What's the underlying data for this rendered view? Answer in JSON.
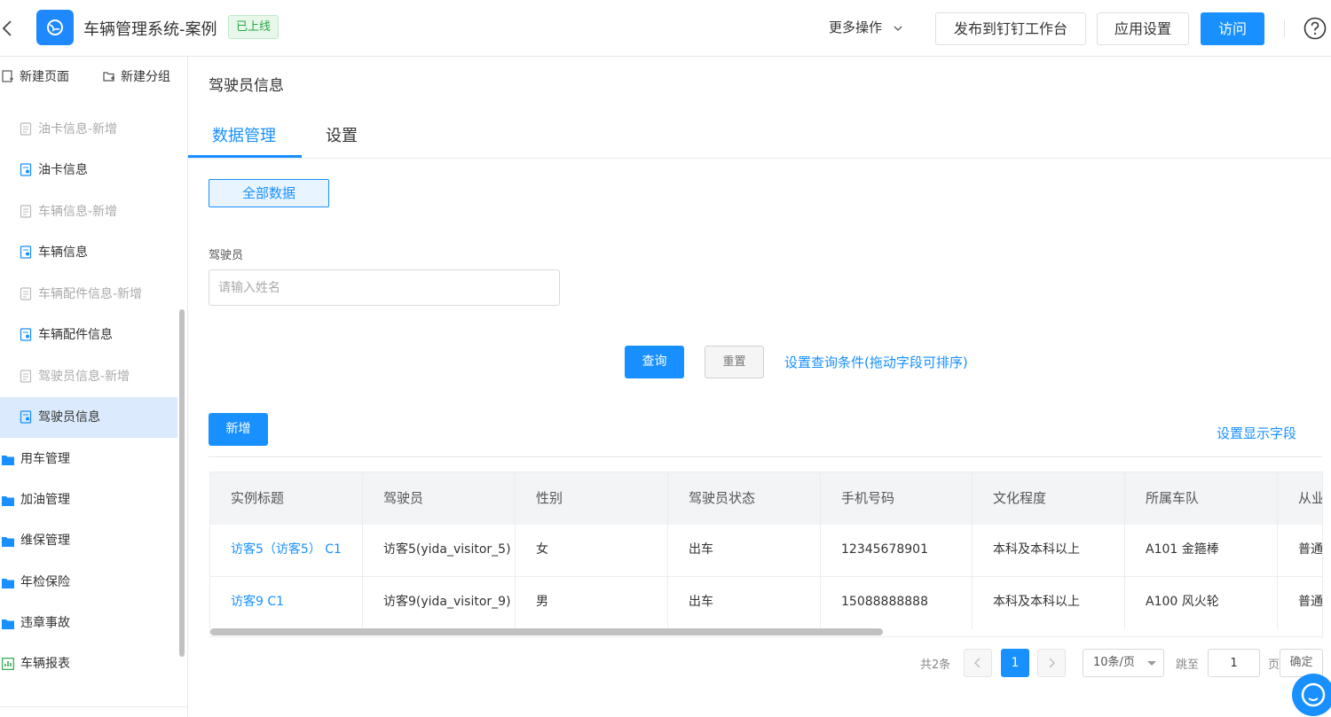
{
  "header": {
    "app_title": "车辆管理系统-案例",
    "status_tag": "已上线",
    "more_ops": "更多操作",
    "publish_btn": "发布到钉钉工作台",
    "settings_btn": "应用设置",
    "visit_btn": "访问"
  },
  "sidebar": {
    "new_page": "新建页面",
    "new_group": "新建分组",
    "items": [
      {
        "label": "油卡信息-新增",
        "kind": "form",
        "muted": true
      },
      {
        "label": "油卡信息",
        "kind": "report",
        "muted": false
      },
      {
        "label": "车辆信息-新增",
        "kind": "form",
        "muted": true
      },
      {
        "label": "车辆信息",
        "kind": "report",
        "muted": false
      },
      {
        "label": "车辆配件信息-新增",
        "kind": "form",
        "muted": true
      },
      {
        "label": "车辆配件信息",
        "kind": "report",
        "muted": false
      },
      {
        "label": "驾驶员信息-新增",
        "kind": "form",
        "muted": true
      },
      {
        "label": "驾驶员信息",
        "kind": "report",
        "muted": false,
        "active": true
      },
      {
        "label": "用车管理",
        "kind": "folder"
      },
      {
        "label": "加油管理",
        "kind": "folder"
      },
      {
        "label": "维保管理",
        "kind": "folder"
      },
      {
        "label": "年检保险",
        "kind": "folder"
      },
      {
        "label": "违章事故",
        "kind": "folder"
      },
      {
        "label": "车辆报表",
        "kind": "chart"
      }
    ]
  },
  "main": {
    "page_title": "驾驶员信息",
    "tabs": [
      {
        "label": "数据管理",
        "active": true
      },
      {
        "label": "设置",
        "active": false
      }
    ],
    "view_chip": "全部数据",
    "filter": {
      "label": "驾驶员",
      "placeholder": "请输入姓名",
      "value": ""
    },
    "query_btn": "查询",
    "reset_btn": "重置",
    "query_cfg_link": "设置查询条件(拖动字段可排序)",
    "add_btn": "新增",
    "fields_link": "设置显示字段"
  },
  "table": {
    "columns": [
      "实例标题",
      "驾驶员",
      "性别",
      "驾驶员状态",
      "手机号码",
      "文化程度",
      "所属车队",
      "从业"
    ],
    "rows": [
      [
        "访客5（访客5） C1",
        "访客5(yida_visitor_5)",
        "女",
        "出车",
        "12345678901",
        "本科及本科以上",
        "A101 金箍棒",
        "普通"
      ],
      [
        "访客9 C1",
        "访客9(yida_visitor_9)",
        "男",
        "出车",
        "15088888888",
        "本科及本科以上",
        "A100 风火轮",
        "普通"
      ]
    ]
  },
  "pagination": {
    "total": "共2条",
    "current": "1",
    "page_size": "10条/页",
    "jump_label": "跳至",
    "jump_value": "1",
    "page_suffix": "页",
    "confirm": "确定"
  },
  "colors": {
    "primary": "#1890ff",
    "online_tag": "#2aa745",
    "active_item_bg": "#dbeafc"
  }
}
